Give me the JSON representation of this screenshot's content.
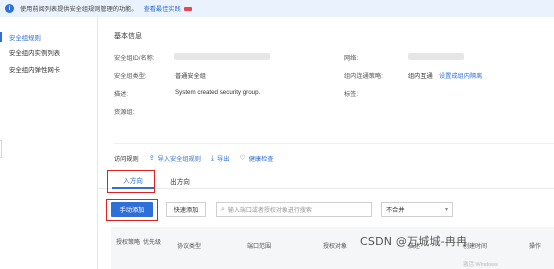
{
  "banner": {
    "text": "使用前阅列表提供安全组规则管理的功能。",
    "link": "查看最佳实践"
  },
  "sidebar": {
    "items": [
      {
        "label": "安全组规则",
        "active": true
      },
      {
        "label": "安全组内实例列表",
        "active": false
      },
      {
        "label": "安全组内弹性网卡",
        "active": false
      }
    ]
  },
  "basic_info": {
    "title": "基本信息",
    "id_label": "安全组ID/名称:",
    "network_label": "网络:",
    "type_label": "安全组类型:",
    "type_value": "普通安全组",
    "intra_policy_label": "组内连通策略:",
    "intra_policy_value": "组内互通",
    "intra_policy_link": "设置成组内隔离",
    "desc_label": "描述:",
    "desc_value": "System created security group.",
    "tag_label": "标签:",
    "resource_group_label": "资源组:"
  },
  "rules": {
    "title": "访问规则",
    "import_link": "导入安全组规则",
    "export_link": "导出",
    "health_link": "健康检查"
  },
  "tabs": [
    {
      "label": "入方向",
      "active": true
    },
    {
      "label": "出方向",
      "active": false
    }
  ],
  "toolbar": {
    "manual_add": "手动添加",
    "quick_add": "快速添加",
    "search_placeholder": "输入端口或者授权对象进行搜索",
    "merge_select": "不合并"
  },
  "table": {
    "headers": [
      "授权策略",
      "优先级",
      "协议类型",
      "端口范围",
      "授权对象",
      "描述",
      "创建时间",
      "操作"
    ]
  },
  "watermark": {
    "csdn": "CSDN @万城城-冉冉",
    "windows": "激活 Windows"
  },
  "colors": {
    "accent": "#2f6fd8",
    "highlight": "#e02020",
    "banner_bg": "#eaf2fd"
  }
}
